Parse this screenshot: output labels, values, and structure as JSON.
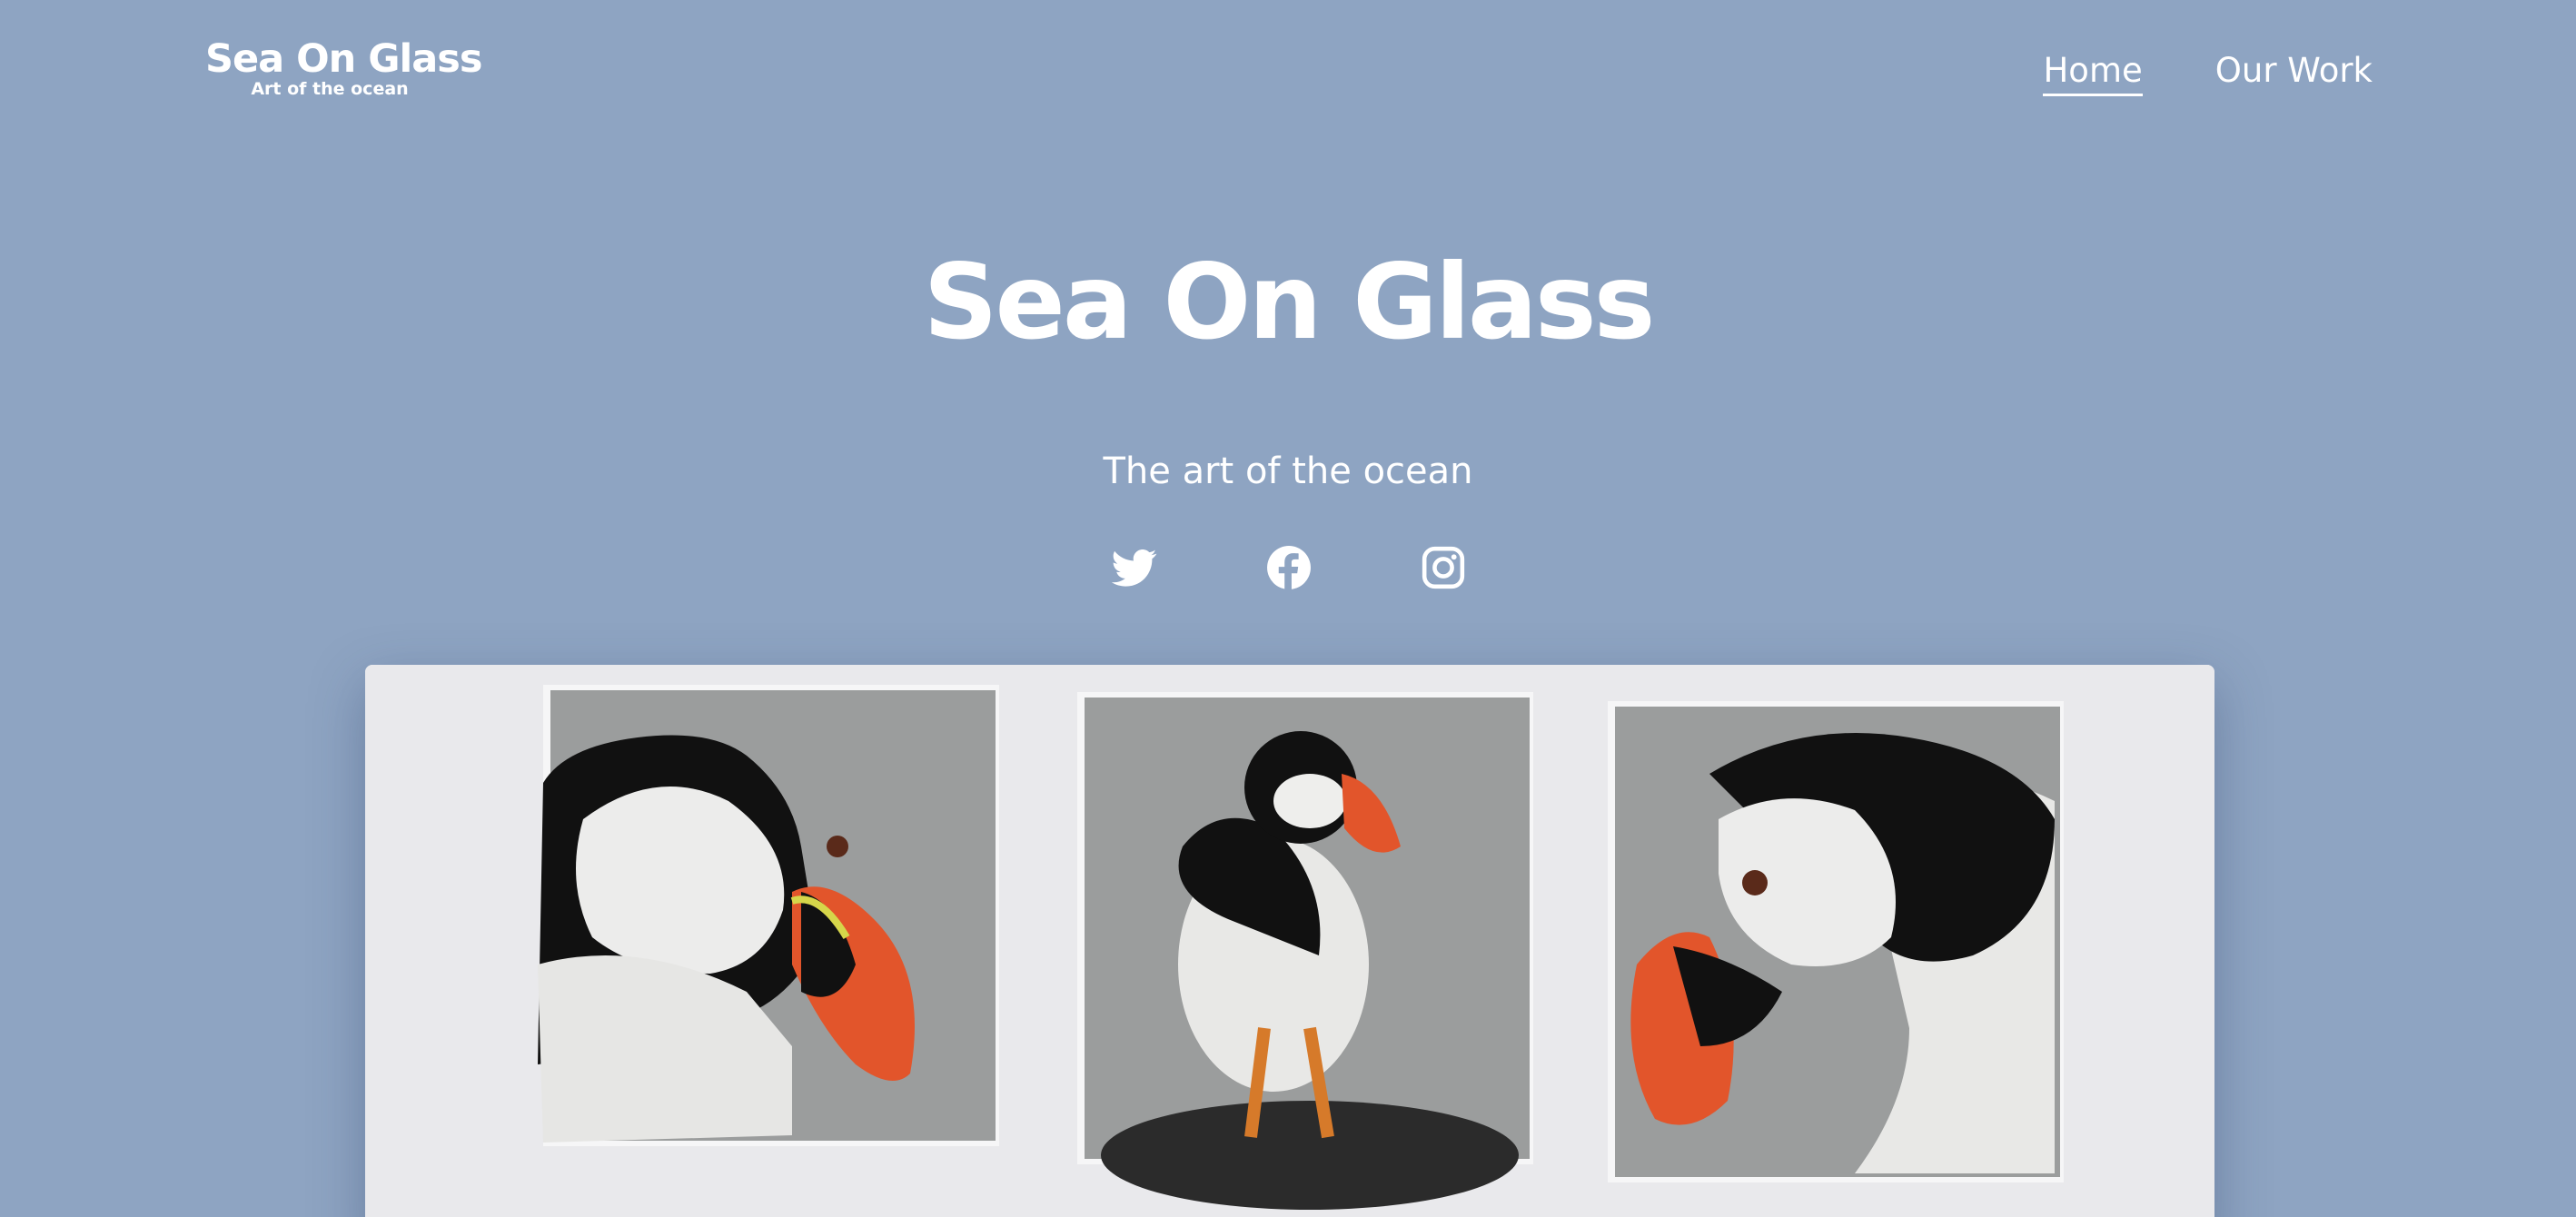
{
  "site": {
    "logo_title": "Sea On Glass",
    "logo_tagline": "Art of the ocean"
  },
  "nav": {
    "items": [
      {
        "label": "Home",
        "active": true
      },
      {
        "label": "Our Work",
        "active": false
      }
    ]
  },
  "hero": {
    "title": "Sea On Glass",
    "subtitle": "The art of the ocean"
  },
  "social": {
    "icons": [
      "twitter-icon",
      "facebook-icon",
      "instagram-icon"
    ]
  },
  "artwork": {
    "subject": "three glass puffins",
    "colors": {
      "background": "#8ea4c2",
      "mat": "#e9e9ec",
      "panel": "#9b9d9d",
      "beak": "#e2552b"
    }
  }
}
